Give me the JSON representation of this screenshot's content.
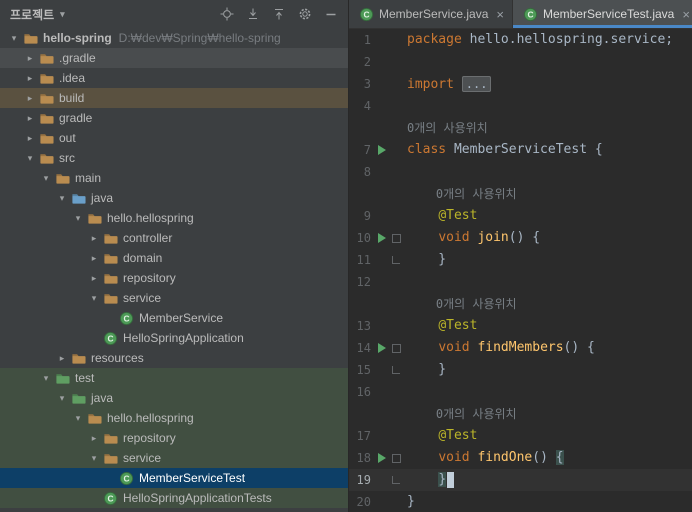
{
  "project_panel": {
    "title": "프로젝트",
    "title_caret_icon": "chevron-down-icon",
    "toolbar_icons": [
      "locate-icon",
      "expand-all-icon",
      "collapse-all-icon",
      "settings-icon",
      "hide-icon"
    ],
    "tree": [
      {
        "label": "hello-spring",
        "sub": "D:₩dev₩Spring₩hello-spring",
        "indent": 0,
        "chevron": "open",
        "icon": "folder",
        "highlight": ""
      },
      {
        "label": ".gradle",
        "indent": 1,
        "chevron": "closed",
        "icon": "folder",
        "highlight": "gray"
      },
      {
        "label": ".idea",
        "indent": 1,
        "chevron": "closed",
        "icon": "folder",
        "highlight": ""
      },
      {
        "label": "build",
        "indent": 1,
        "chevron": "closed",
        "icon": "folder",
        "highlight": "excluded"
      },
      {
        "label": "gradle",
        "indent": 1,
        "chevron": "closed",
        "icon": "folder",
        "highlight": ""
      },
      {
        "label": "out",
        "indent": 1,
        "chevron": "closed",
        "icon": "folder",
        "highlight": ""
      },
      {
        "label": "src",
        "indent": 1,
        "chevron": "open",
        "icon": "folder",
        "highlight": ""
      },
      {
        "label": "main",
        "indent": 2,
        "chevron": "open",
        "icon": "folder",
        "highlight": ""
      },
      {
        "label": "java",
        "indent": 3,
        "chevron": "open",
        "icon": "folder-source",
        "highlight": ""
      },
      {
        "label": "hello.hellospring",
        "indent": 4,
        "chevron": "open",
        "icon": "package",
        "highlight": ""
      },
      {
        "label": "controller",
        "indent": 5,
        "chevron": "closed",
        "icon": "package",
        "highlight": ""
      },
      {
        "label": "domain",
        "indent": 5,
        "chevron": "closed",
        "icon": "package",
        "highlight": ""
      },
      {
        "label": "repository",
        "indent": 5,
        "chevron": "closed",
        "icon": "package",
        "highlight": ""
      },
      {
        "label": "service",
        "indent": 5,
        "chevron": "open",
        "icon": "package",
        "highlight": ""
      },
      {
        "label": "MemberService",
        "indent": 6,
        "chevron": "none",
        "icon": "class",
        "highlight": ""
      },
      {
        "label": "HelloSpringApplication",
        "indent": 5,
        "chevron": "none",
        "icon": "class",
        "highlight": ""
      },
      {
        "label": "resources",
        "indent": 3,
        "chevron": "closed",
        "icon": "folder",
        "highlight": ""
      },
      {
        "label": "test",
        "indent": 2,
        "chevron": "open",
        "icon": "folder-test",
        "highlight": "test"
      },
      {
        "label": "java",
        "indent": 3,
        "chevron": "open",
        "icon": "folder-test",
        "highlight": "test"
      },
      {
        "label": "hello.hellospring",
        "indent": 4,
        "chevron": "open",
        "icon": "package",
        "highlight": "test"
      },
      {
        "label": "repository",
        "indent": 5,
        "chevron": "closed",
        "icon": "package",
        "highlight": "test"
      },
      {
        "label": "service",
        "indent": 5,
        "chevron": "open",
        "icon": "package",
        "highlight": "test"
      },
      {
        "label": "MemberServiceTest",
        "indent": 6,
        "chevron": "none",
        "icon": "class",
        "highlight": "selected"
      },
      {
        "label": "HelloSpringApplicationTests",
        "indent": 5,
        "chevron": "none",
        "icon": "class",
        "highlight": "test"
      }
    ]
  },
  "editor": {
    "tabs": [
      {
        "label": "MemberService.java",
        "icon": "class",
        "close": "×",
        "active": false
      },
      {
        "label": "MemberServiceTest.java",
        "icon": "class",
        "close": "×",
        "active": true
      }
    ],
    "lines": [
      {
        "num": "1",
        "tokens": [
          {
            "t": "package ",
            "c": "kw"
          },
          {
            "t": "hello.hellospring.service;",
            "c": "pl"
          }
        ]
      },
      {
        "num": "2",
        "tokens": []
      },
      {
        "num": "3",
        "tokens": [
          {
            "t": "import ",
            "c": "kw"
          },
          {
            "t": "...",
            "c": "fold"
          }
        ]
      },
      {
        "num": "4",
        "tokens": []
      },
      {
        "inlay": "0개의 사용위치"
      },
      {
        "num": "7",
        "run": true,
        "tokens": [
          {
            "t": "class ",
            "c": "kw"
          },
          {
            "t": "MemberServiceTest {",
            "c": "pl"
          }
        ]
      },
      {
        "num": "8",
        "tokens": []
      },
      {
        "inlay": "    0개의 사용위치"
      },
      {
        "num": "9",
        "tokens": [
          {
            "t": "    ",
            "c": "pl"
          },
          {
            "t": "@Test",
            "c": "ann"
          }
        ]
      },
      {
        "num": "10",
        "run": true,
        "fold": "start",
        "tokens": [
          {
            "t": "    ",
            "c": "pl"
          },
          {
            "t": "void ",
            "c": "kw"
          },
          {
            "t": "join",
            "c": "fn"
          },
          {
            "t": "() {",
            "c": "pl"
          }
        ]
      },
      {
        "num": "11",
        "fold": "end",
        "tokens": [
          {
            "t": "    }",
            "c": "pl"
          }
        ]
      },
      {
        "num": "12",
        "tokens": []
      },
      {
        "inlay": "    0개의 사용위치"
      },
      {
        "num": "13",
        "tokens": [
          {
            "t": "    ",
            "c": "pl"
          },
          {
            "t": "@Test",
            "c": "ann"
          }
        ]
      },
      {
        "num": "14",
        "run": true,
        "fold": "start",
        "tokens": [
          {
            "t": "    ",
            "c": "pl"
          },
          {
            "t": "void ",
            "c": "kw"
          },
          {
            "t": "findMembers",
            "c": "fn"
          },
          {
            "t": "() {",
            "c": "pl"
          }
        ]
      },
      {
        "num": "15",
        "fold": "end",
        "tokens": [
          {
            "t": "    }",
            "c": "pl"
          }
        ]
      },
      {
        "num": "16",
        "tokens": []
      },
      {
        "inlay": "    0개의 사용위치"
      },
      {
        "num": "17",
        "tokens": [
          {
            "t": "    ",
            "c": "pl"
          },
          {
            "t": "@Test",
            "c": "ann"
          }
        ]
      },
      {
        "num": "18",
        "run": true,
        "fold": "start",
        "tokens": [
          {
            "t": "    ",
            "c": "pl"
          },
          {
            "t": "void ",
            "c": "kw"
          },
          {
            "t": "findOne",
            "c": "fn"
          },
          {
            "t": "() ",
            "c": "pl"
          },
          {
            "t": "{",
            "c": "brace"
          }
        ]
      },
      {
        "num": "19",
        "fold": "end",
        "current": true,
        "caret": true,
        "tokens": [
          {
            "t": "    ",
            "c": "pl"
          },
          {
            "t": "}",
            "c": "brace"
          }
        ]
      },
      {
        "num": "20",
        "tokens": [
          {
            "t": "}",
            "c": "pl"
          }
        ]
      }
    ]
  },
  "colors": {
    "panel_bg": "#3c3f41",
    "editor_bg": "#2b2b2b",
    "selection_blue": "#0d3f67",
    "test_scope_green": "#414f41",
    "excluded_tan": "#5a5140",
    "hover_gray": "#494c4e",
    "tab_accent_blue": "#4a88c7",
    "run_green": "#59a869",
    "keyword_orange": "#cc7832",
    "annotation_yellow": "#bbb529",
    "method_yellow": "#ffc66d",
    "inlay_gray": "#787f85",
    "folder_tan": "#b98c50",
    "class_green": "#4d9a57"
  }
}
